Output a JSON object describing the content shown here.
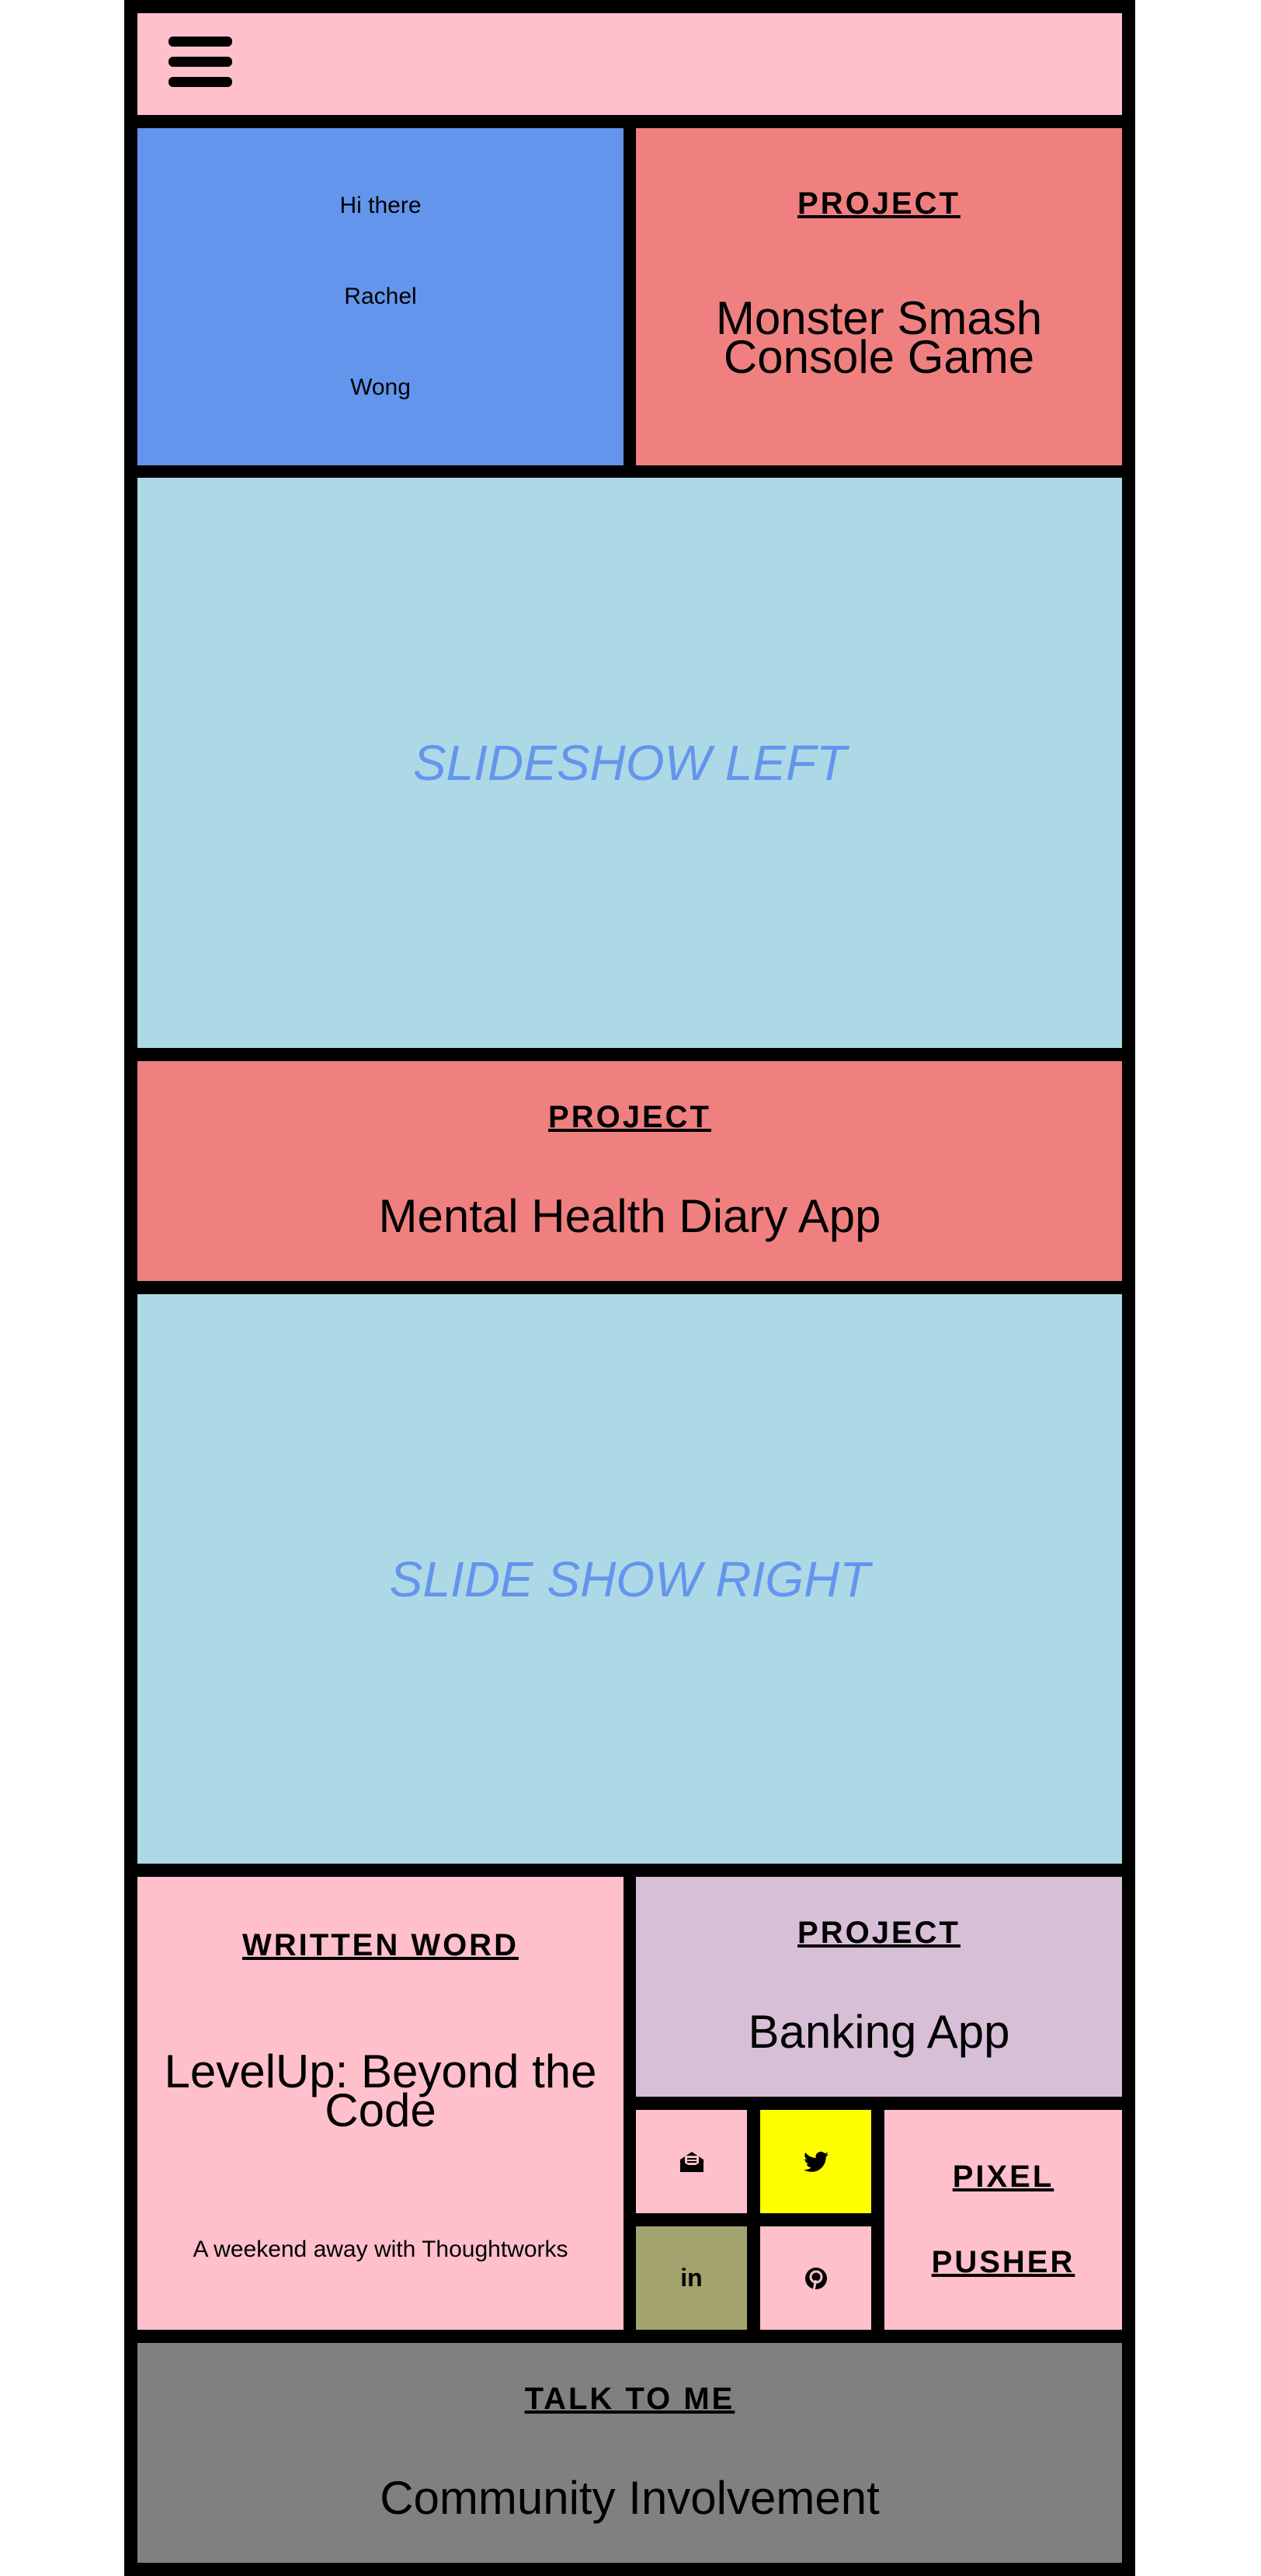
{
  "header": {
    "menu_icon": "hamburger-menu-icon"
  },
  "intro": {
    "line1": "Hi there",
    "line2": "Rachel",
    "line3": "Wong"
  },
  "project1": {
    "eyebrow": "PROJECT",
    "title": "Monster Smash Console Game"
  },
  "slideshow_left": {
    "label": "SLIDESHOW LEFT"
  },
  "project2": {
    "eyebrow": "PROJECT",
    "title": "Mental Health Diary App"
  },
  "slideshow_right": {
    "label": "SLIDE SHOW RIGHT"
  },
  "written_word": {
    "eyebrow": "WRITTEN WORD",
    "title": "LevelUp: Beyond the Code",
    "subtitle": "A weekend away with Thoughtworks"
  },
  "project3": {
    "eyebrow": "PROJECT",
    "title": "Banking App"
  },
  "social": {
    "email_icon": "envelope-open-icon",
    "twitter_icon": "twitter-bird-icon",
    "linkedin_icon": "linkedin-icon",
    "linkedin_text": "in",
    "pinterest_icon": "pinterest-icon"
  },
  "pixel_pusher": {
    "line1": "PIXEL",
    "line2": "PUSHER"
  },
  "footer": {
    "eyebrow": "TALK TO ME",
    "title": "Community Involvement"
  },
  "colors": {
    "pink": "#ffc0cb",
    "blue": "#6495ed",
    "coral": "#f08080",
    "lightblue": "#add8e6",
    "thistle": "#d8bfd8",
    "yellow": "#ffff00",
    "olive": "#a3a36d",
    "gray": "#808080"
  }
}
